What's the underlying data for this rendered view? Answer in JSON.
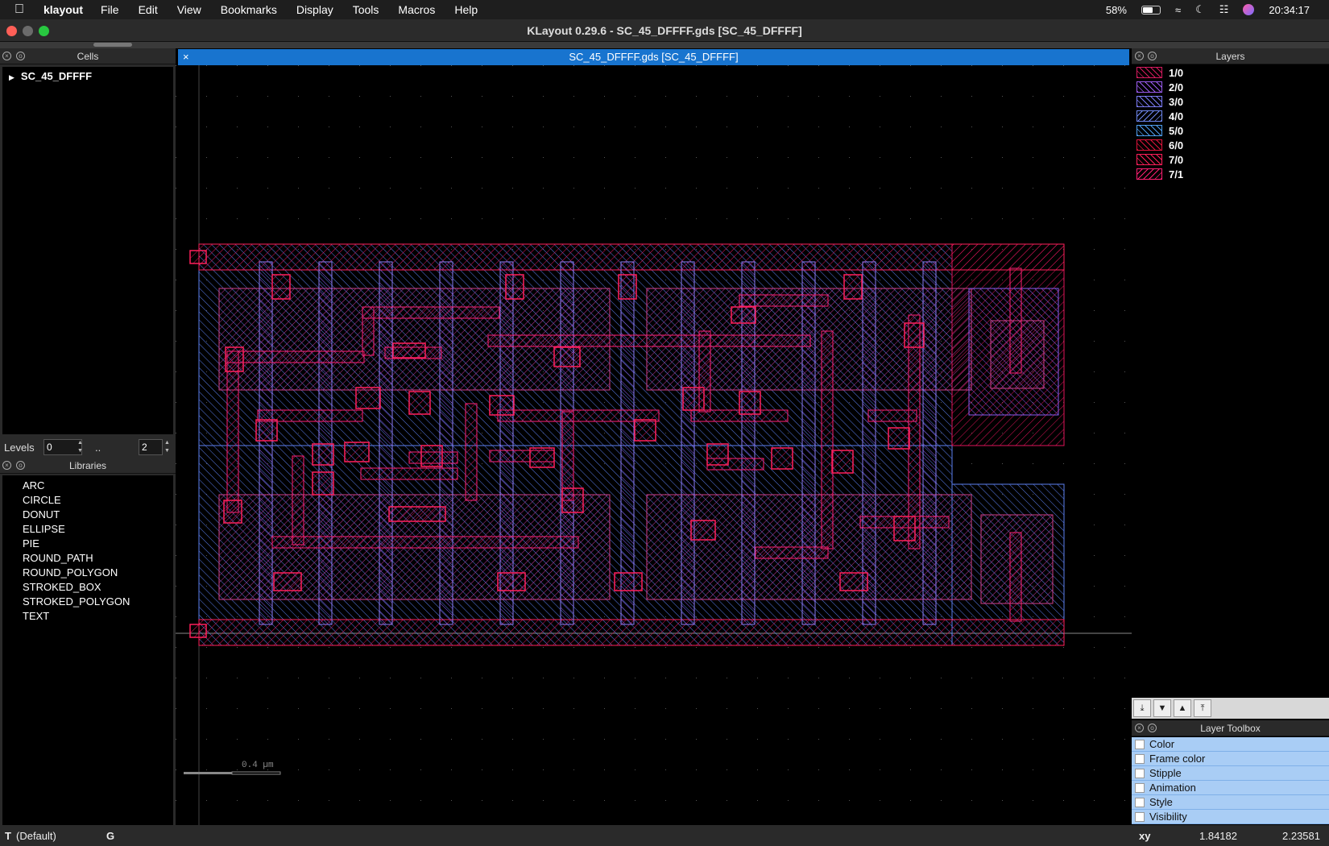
{
  "menubar": {
    "app": "klayout",
    "items": [
      "File",
      "Edit",
      "View",
      "Bookmarks",
      "Display",
      "Tools",
      "Macros",
      "Help"
    ],
    "battery": "58%",
    "clock": "20:34:17"
  },
  "window": {
    "title": "KLayout 0.29.6 - SC_45_DFFFF.gds [SC_45_DFFFF]"
  },
  "cells": {
    "header": "Cells",
    "root": "SC_45_DFFFF"
  },
  "levels": {
    "label": "Levels",
    "from": "0",
    "sep": "..",
    "to": "2"
  },
  "libraries": {
    "header": "Libraries",
    "items": [
      "ARC",
      "CIRCLE",
      "DONUT",
      "ELLIPSE",
      "PIE",
      "ROUND_PATH",
      "ROUND_POLYGON",
      "STROKED_BOX",
      "STROKED_POLYGON",
      "TEXT"
    ]
  },
  "view": {
    "tab_title": "SC_45_DFFFF.gds [SC_45_DFFFF]",
    "scale_label": "0.4 µm"
  },
  "layers": {
    "header": "Layers",
    "items": [
      {
        "name": "1/0",
        "color": "#d81b60"
      },
      {
        "name": "2/0",
        "color": "#9c5cf0"
      },
      {
        "name": "3/0",
        "color": "#7b7bf5"
      },
      {
        "name": "4/0",
        "color": "#6f88f0"
      },
      {
        "name": "5/0",
        "color": "#4f9ff0"
      },
      {
        "name": "6/0",
        "color": "#e0143c"
      },
      {
        "name": "7/0",
        "color": "#ff1f5a"
      },
      {
        "name": "7/1",
        "color": "#ff1f73"
      }
    ]
  },
  "toolbox": {
    "header": "Layer Toolbox",
    "items": [
      "Color",
      "Frame color",
      "Stipple",
      "Animation",
      "Style",
      "Visibility"
    ]
  },
  "status": {
    "mode": "T",
    "mode_desc": "(Default)",
    "grid": "G",
    "coord_label": "xy",
    "x": "1.84182",
    "y": "2.23581"
  }
}
